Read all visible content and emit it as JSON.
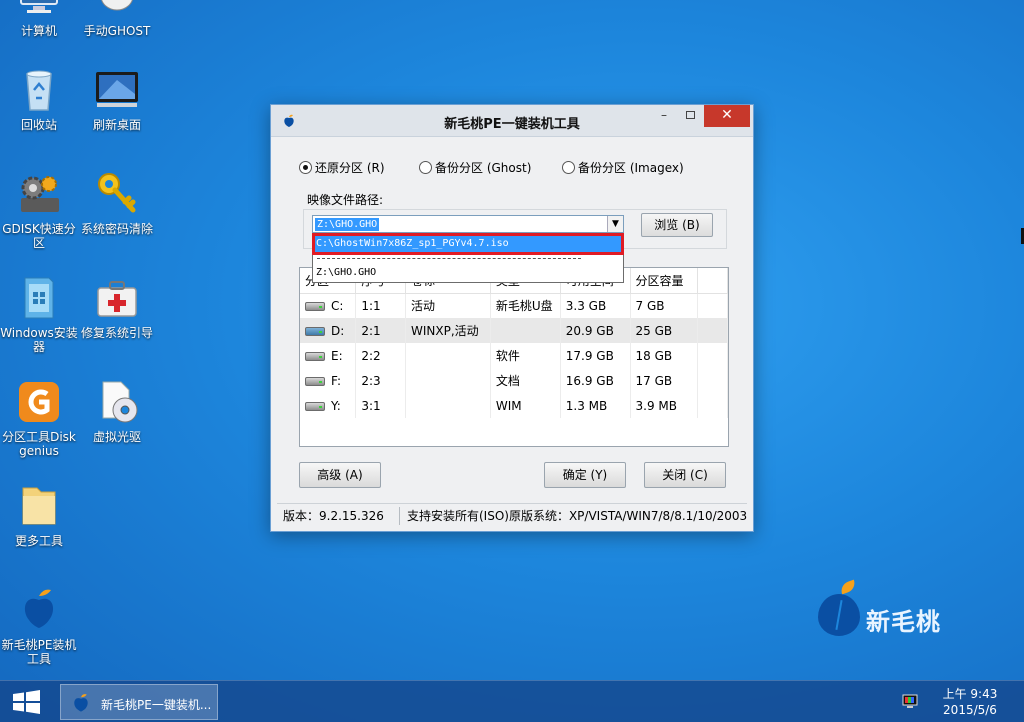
{
  "desktop": {
    "icons": [
      {
        "label": "计算机"
      },
      {
        "label": "手动GHOST"
      },
      {
        "label": "回收站"
      },
      {
        "label": "刷新桌面"
      },
      {
        "label": "GDISK快速分区"
      },
      {
        "label": "系统密码清除"
      },
      {
        "label": "Windows安装器"
      },
      {
        "label": "修复系统引导"
      },
      {
        "label": "分区工具Diskgenius"
      },
      {
        "label": "虚拟光驱"
      },
      {
        "label": "更多工具"
      },
      {
        "label": "新毛桃PE装机工具"
      }
    ],
    "brand_name": "新毛桃",
    "brand_color": "#0a4fa3"
  },
  "dialog": {
    "title": "新毛桃PE一键装机工具",
    "window_buttons": {
      "minimize": "–",
      "close": "✕"
    },
    "radio_restore": "还原分区 (R)",
    "radio_backup_ghost": "备份分区 (Ghost)",
    "radio_backup_imagex": "备份分区 (Imagex)",
    "selected_mode": "restore",
    "path_label": "映像文件路径:",
    "path_value": "Z:\\GHO.GHO",
    "browse_button": "浏览 (B)",
    "dropdown": {
      "selected_item": "C:\\GhostWin7x86Z_sp1_PGYv4.7.iso",
      "other_item": "Z:\\GHO.GHO",
      "highlight_color": "#e01b24"
    },
    "table": {
      "headers": [
        "分区",
        "序号",
        "卷标",
        "类型",
        "可用空间",
        "分区容量"
      ],
      "rows": [
        {
          "drive": "C:",
          "index": "1:1",
          "label": "活动",
          "type": "新毛桃U盘",
          "free": "3.3 GB",
          "size": "7 GB",
          "usb": false,
          "selected": false
        },
        {
          "drive": "D:",
          "index": "2:1",
          "label": "WINXP,活动",
          "type": "",
          "free": "20.9 GB",
          "size": "25 GB",
          "usb": true,
          "selected": true
        },
        {
          "drive": "E:",
          "index": "2:2",
          "label": "",
          "type": "软件",
          "free": "17.9 GB",
          "size": "18 GB",
          "usb": false,
          "selected": false
        },
        {
          "drive": "F:",
          "index": "2:3",
          "label": "",
          "type": "文档",
          "free": "16.9 GB",
          "size": "17 GB",
          "usb": false,
          "selected": false
        },
        {
          "drive": "Y:",
          "index": "3:1",
          "label": "",
          "type": "WIM",
          "free": "1.3 MB",
          "size": "3.9 MB",
          "usb": false,
          "selected": false
        }
      ]
    },
    "advanced_button": "高级 (A)",
    "ok_button": "确定 (Y)",
    "cancel_button": "关闭 (C)",
    "version": "版本：9.2.15.326",
    "supported_systems": "支持安装所有(ISO)原版系统：XP/VISTA/WIN7/8/8.1/10/2003,"
  },
  "taskbar": {
    "task_label": "新毛桃PE一键装机...",
    "time": "上午 9:43",
    "date": "2015/5/6"
  }
}
